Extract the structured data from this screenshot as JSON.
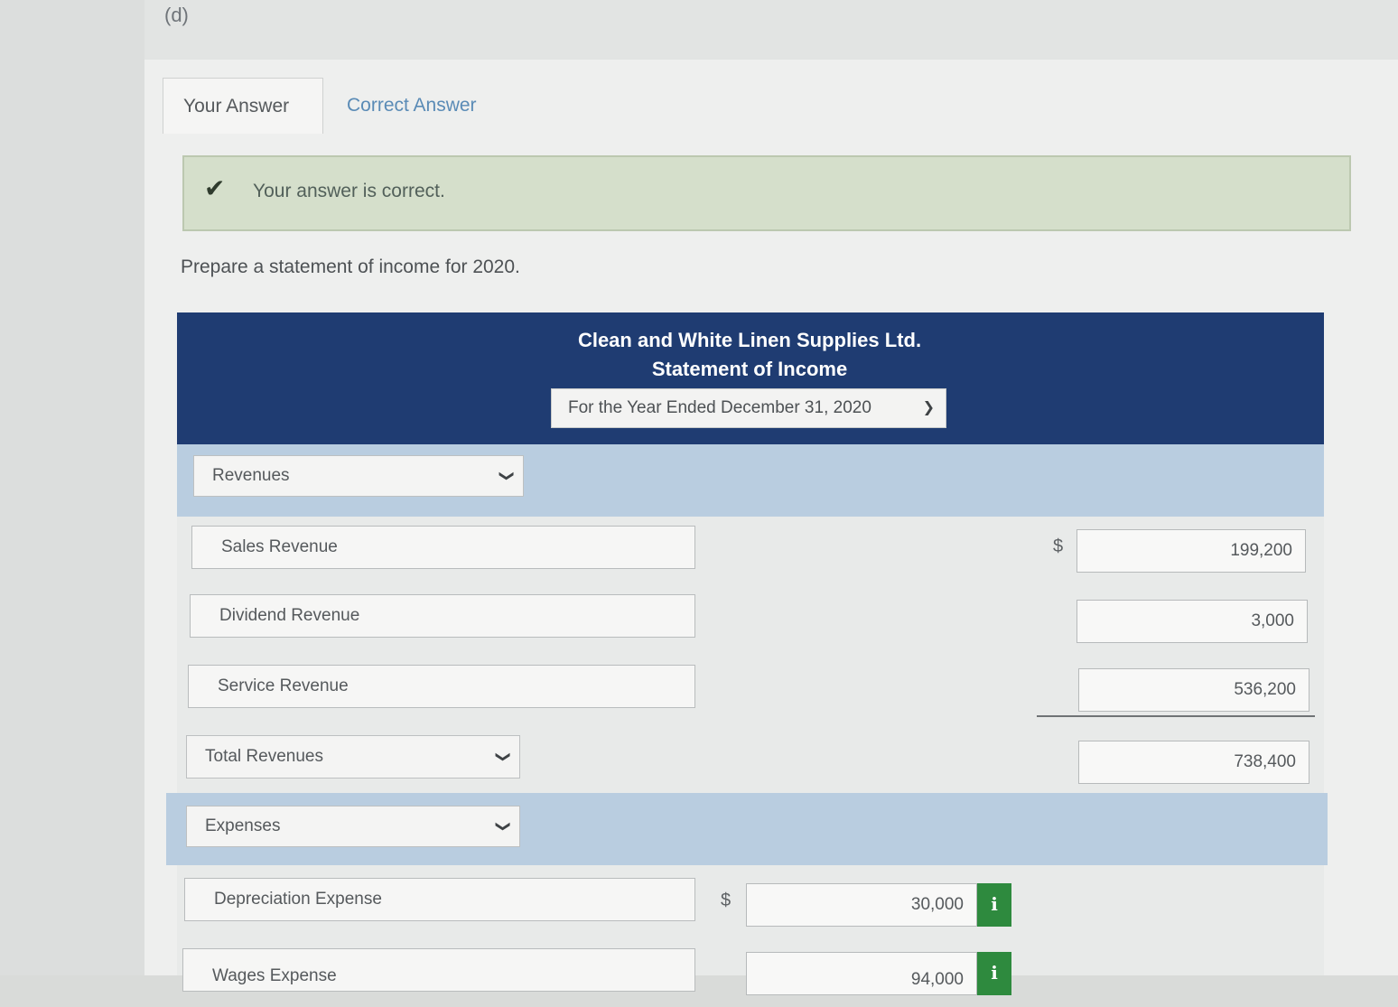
{
  "part_label": "(d)",
  "tabs": [
    {
      "label": "Your Answer",
      "active": true
    },
    {
      "label": "Correct Answer",
      "active": false
    }
  ],
  "feedback": {
    "icon": "check-icon",
    "message": "Your answer is correct."
  },
  "instruction": "Prepare a statement of income for 2020.",
  "statement": {
    "company": "Clean and White Linen Supplies Ltd.",
    "title": "Statement of Income",
    "period": "For the Year Ended December 31, 2020"
  },
  "revenues": {
    "heading": "Revenues",
    "items": [
      {
        "label": "Sales Revenue",
        "currency": "$",
        "amount": "199,200"
      },
      {
        "label": "Dividend Revenue",
        "amount": "3,000"
      },
      {
        "label": "Service Revenue",
        "amount": "536,200"
      }
    ],
    "total_label": "Total Revenues",
    "total_amount": "738,400"
  },
  "expenses": {
    "heading": "Expenses",
    "items": [
      {
        "label": "Depreciation Expense",
        "currency": "$",
        "amount": "30,000"
      },
      {
        "label": "Wages Expense",
        "amount": "94,000"
      }
    ]
  },
  "colors": {
    "header_bg": "#1f3c72",
    "band_bg": "#b9cde0",
    "success_bg": "#d5dfcb",
    "info_badge": "#2e8a3e",
    "tab_link": "#5a8bb6"
  }
}
